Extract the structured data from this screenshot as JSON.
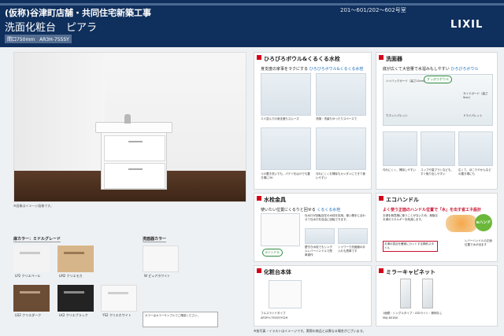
{
  "header": {
    "project": "(仮称)谷津町店舗・共同住宅新築工事",
    "title": "洗面化粧台　ピアラ",
    "subtitle": "間口750mm　AR3H-755SY",
    "units": "201～601/202～602号室",
    "logo": "LIXIL"
  },
  "photo": {
    "caption": "※画像はイメージ画像です。"
  },
  "swatches": {
    "body_heading": "扉カラー：ミドルグレード",
    "counter_heading": "洗面器カラー",
    "items": [
      {
        "code": "LP2",
        "name": "クリエペール",
        "color": "#f2f3f2",
        "bar": "#c9c9c9"
      },
      {
        "code": "LM2",
        "name": "クリエモカ",
        "color": "#d7b58a",
        "bar": "#9a7a55"
      },
      {
        "code": "LD2",
        "name": "クリエダーク",
        "color": "#6b4c35",
        "bar": "#b89c84"
      },
      {
        "code": "LK2",
        "name": "クリエブラック",
        "color": "#232323",
        "bar": "#8a8a8a"
      },
      {
        "code": "YS2",
        "name": "クリエホワイト",
        "color": "#f8f8f8",
        "bar": "#cfcfcf"
      }
    ],
    "counter": {
      "code": "W",
      "name": "ピュアホワイト",
      "color": "#f7f7f7"
    },
    "note": "カラーはカラーサンプルでご確認ください。"
  },
  "panels": {
    "bowl": {
      "title": "ひろびろボウル&くるくる水栓",
      "lead": "身支度の家事をラクにする",
      "lead_hl": "ひろびろボウル&くるくる水栓",
      "captions": [
        "２人並んでの身支度もスムーズ",
        "洗顔・洗髪もゆったりスペースで",
        "つけ置き洗いでも、パテツをはけでも置き場にOK",
        "汚れにくくお掃除もカンタンにできて使いやすい"
      ]
    },
    "basin": {
      "title": "洗面器",
      "lead": "底が広くて大容量で水溜みもしやすい",
      "lead_hl": "ひろびろボウル",
      "tag": "すっきりボウル",
      "labels": [
        "ハイバックガード（高さ10cm）",
        "サイドガード（高さ9cm）",
        "ウエットパレット",
        "ドライパレット"
      ],
      "captions": [
        "汚れにくく、掃除しやすい",
        "コップや歯ブラシなども、すぐ取り出しやすい",
        "広くて、ほこりやかんなどの置き場にも"
      ]
    },
    "faucet": {
      "title": "水栓金具",
      "lead": "使いたい位置にくるりと回せる",
      "lead_hl": "くるくる水栓",
      "text": "吐水口が回転自在の水栓を採用。使い勝手に合わせて吐水口を自由に回転できます。",
      "tag": "eハンドル",
      "captions": [
        "壁付き水栓でもシングルレバーハンドルで簡単操作",
        "シャワーで洗面器の手入れも簡単です"
      ]
    },
    "eco": {
      "title": "エコハンドル",
      "lead": "よく使う正面のハンドル位置で「水」を出す省エネ設計",
      "text": "お湯を無意識に使うことがないため、無駄なお湯のエネルギーを削減します。",
      "badge": "eハンドル",
      "captions": [
        "お湯の混合を確実にカットする節約スタイル",
        "レバーハンドルの正面位置で水が出ます"
      ]
    },
    "vanity": {
      "title": "化粧台本体",
      "label": "フルスライドタイプ",
      "model": "AR3FH-755SY/YS2H"
    },
    "mirror": {
      "title": "ミラーキャビネット",
      "label": "1面鏡・シングルタイプ・LEDライト・照明なし",
      "model": "MAJ-601NU"
    }
  },
  "footer": "※各写真・イラストはイメージです。実際の商品とは異なる場合がございます。"
}
